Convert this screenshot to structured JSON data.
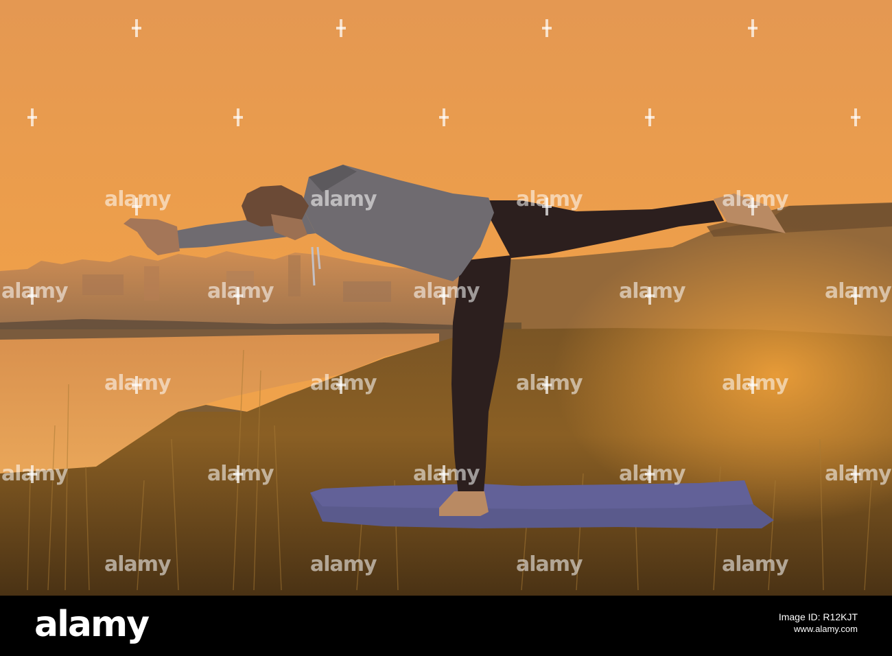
{
  "watermark": {
    "text": "alamy"
  },
  "footer": {
    "logo": "alamy",
    "image_id": "Image ID: R12KJT",
    "site": "www.alamy.com"
  },
  "colors": {
    "sky_top": "#e59a52",
    "sky_bottom": "#f1a24b",
    "river": "#e39a4f",
    "grass": "#6b4a1c",
    "hoodie": "#6d6a6f",
    "pants": "#2b1e1c",
    "mat": "#5c5a8a",
    "footer_bg": "#000000"
  }
}
